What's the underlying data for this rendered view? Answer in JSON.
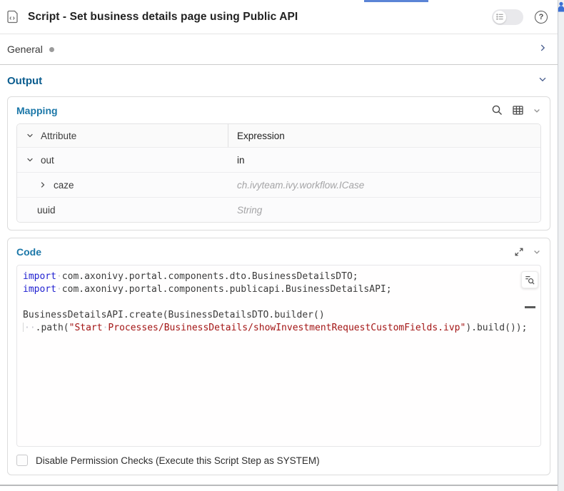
{
  "colors": {
    "section_blue": "#1b77a8",
    "section_blue_dark": "#0b5d8f",
    "keyword_blue": "#1f1fd0",
    "string_red": "#a31515",
    "tab_accent": "#5b84d6"
  },
  "window": {
    "title": "Script - Set business details page using Public API"
  },
  "sections": {
    "general": {
      "label": "General"
    },
    "output": {
      "label": "Output"
    }
  },
  "mapping": {
    "title": "Mapping",
    "columns": [
      "Attribute",
      "Expression"
    ],
    "rows": [
      {
        "attribute": "out",
        "expander": "down",
        "level": 0,
        "expression": "in",
        "placeholder": false
      },
      {
        "attribute": "caze",
        "expander": "right",
        "level": 1,
        "expression": "ch.ivyteam.ivy.workflow.ICase",
        "placeholder": true
      },
      {
        "attribute": "uuid",
        "expander": "none",
        "level": 1,
        "expression": "String",
        "placeholder": true
      }
    ]
  },
  "code": {
    "title": "Code",
    "lines": [
      [
        {
          "t": "import",
          "c": "kw"
        },
        {
          "t": "·",
          "c": "ws"
        },
        {
          "t": "com.axonivy.portal.components.dto.BusinessDetailsDTO;",
          "c": "pl"
        }
      ],
      [
        {
          "t": "import",
          "c": "kw"
        },
        {
          "t": "·",
          "c": "ws"
        },
        {
          "t": "com.axonivy.portal.components.publicapi.BusinessDetailsAPI;",
          "c": "pl"
        }
      ],
      [],
      [
        {
          "t": "BusinessDetailsAPI.create(BusinessDetailsDTO.builder()",
          "c": "pl"
        }
      ],
      [
        {
          "t": "",
          "c": "guide"
        },
        {
          "t": "··",
          "c": "ws"
        },
        {
          "t": ".path(",
          "c": "pl"
        },
        {
          "t": "\"Start",
          "c": "str"
        },
        {
          "t": "·",
          "c": "ws"
        },
        {
          "t": "Processes/BusinessDetails/showInvestmentRequestCustomFields.ivp\"",
          "c": "str"
        },
        {
          "t": ").build());",
          "c": "pl"
        }
      ]
    ]
  },
  "footer": {
    "checkbox_label": "Disable Permission Checks (Execute this Script Step as SYSTEM)",
    "checked": false
  },
  "icons": [
    "script-icon",
    "description-toggle-icon",
    "help-icon",
    "chevron-right-icon",
    "chevron-down-icon",
    "search-icon",
    "table-icon",
    "expand-icon",
    "find-in-code-icon",
    "user-icon"
  ]
}
